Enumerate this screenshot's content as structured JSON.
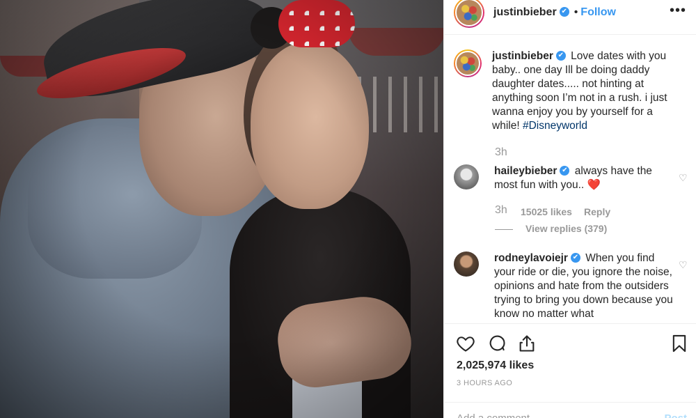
{
  "header": {
    "username": "justinbieber",
    "verified_glyph": "✔",
    "separator": "•",
    "follow_label": "Follow",
    "more_glyph": "•••"
  },
  "caption": {
    "username": "justinbieber",
    "text": "Love dates with you baby.. one day Ill be doing daddy daughter dates..... not hinting at anything soon I’m not in a rush. i just wanna enjoy you by yourself for a while!",
    "hashtag": "#Disneyworld",
    "time": "3h"
  },
  "comments": [
    {
      "username": "haileybieber",
      "text": "always have the most fun with you..",
      "emoji": "❤️",
      "time": "3h",
      "likes": "15025 likes",
      "reply_label": "Reply",
      "view_replies": "View replies (379)"
    },
    {
      "username": "rodneylavoiejr",
      "text": "When you find your ride or die, you ignore the noise, opinions and hate from the outsiders trying to bring you down because you know no matter what"
    }
  ],
  "actions": {
    "likes_count": "2,025,974 likes",
    "timestamp": "3 HOURS AGO"
  },
  "add_comment": {
    "placeholder": "Add a comment…",
    "post_label": "Post"
  },
  "icons": [
    "heart-icon",
    "comment-icon",
    "share-icon",
    "bookmark-icon",
    "verified-icon",
    "more-icon"
  ],
  "colors": {
    "link_blue": "#3897f0",
    "hashtag": "#003569",
    "muted": "#999999"
  }
}
